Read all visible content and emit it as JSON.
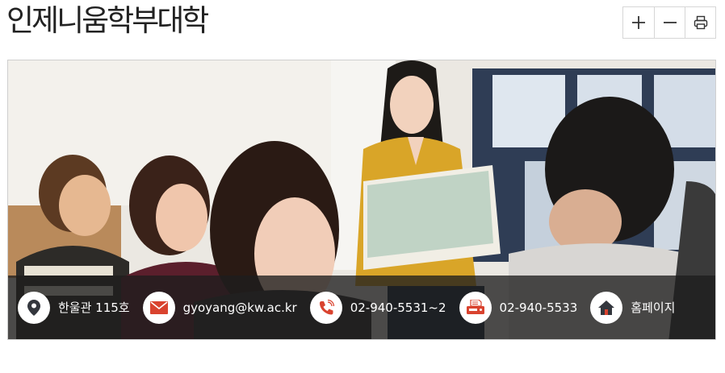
{
  "page": {
    "title": "인제니움학부대학"
  },
  "toolbar": {
    "zoom_in_icon": "plus-icon",
    "zoom_out_icon": "minus-icon",
    "print_icon": "printer-icon"
  },
  "hero": {
    "image_subject": "classroom photo of students",
    "info": [
      {
        "icon": "map-pin-icon",
        "text": "한울관 115호"
      },
      {
        "icon": "envelope-icon",
        "text": "gyoyang@kw.ac.kr"
      },
      {
        "icon": "phone-icon",
        "text": "02-940-5531~2"
      },
      {
        "icon": "fax-icon",
        "text": "02-940-5533"
      },
      {
        "icon": "home-icon",
        "text": "홈페이지"
      }
    ]
  },
  "colors": {
    "bar_background": "#1e1e1e",
    "icon_red": "#d9432f",
    "icon_dark": "#333333",
    "title_text": "#222222"
  }
}
